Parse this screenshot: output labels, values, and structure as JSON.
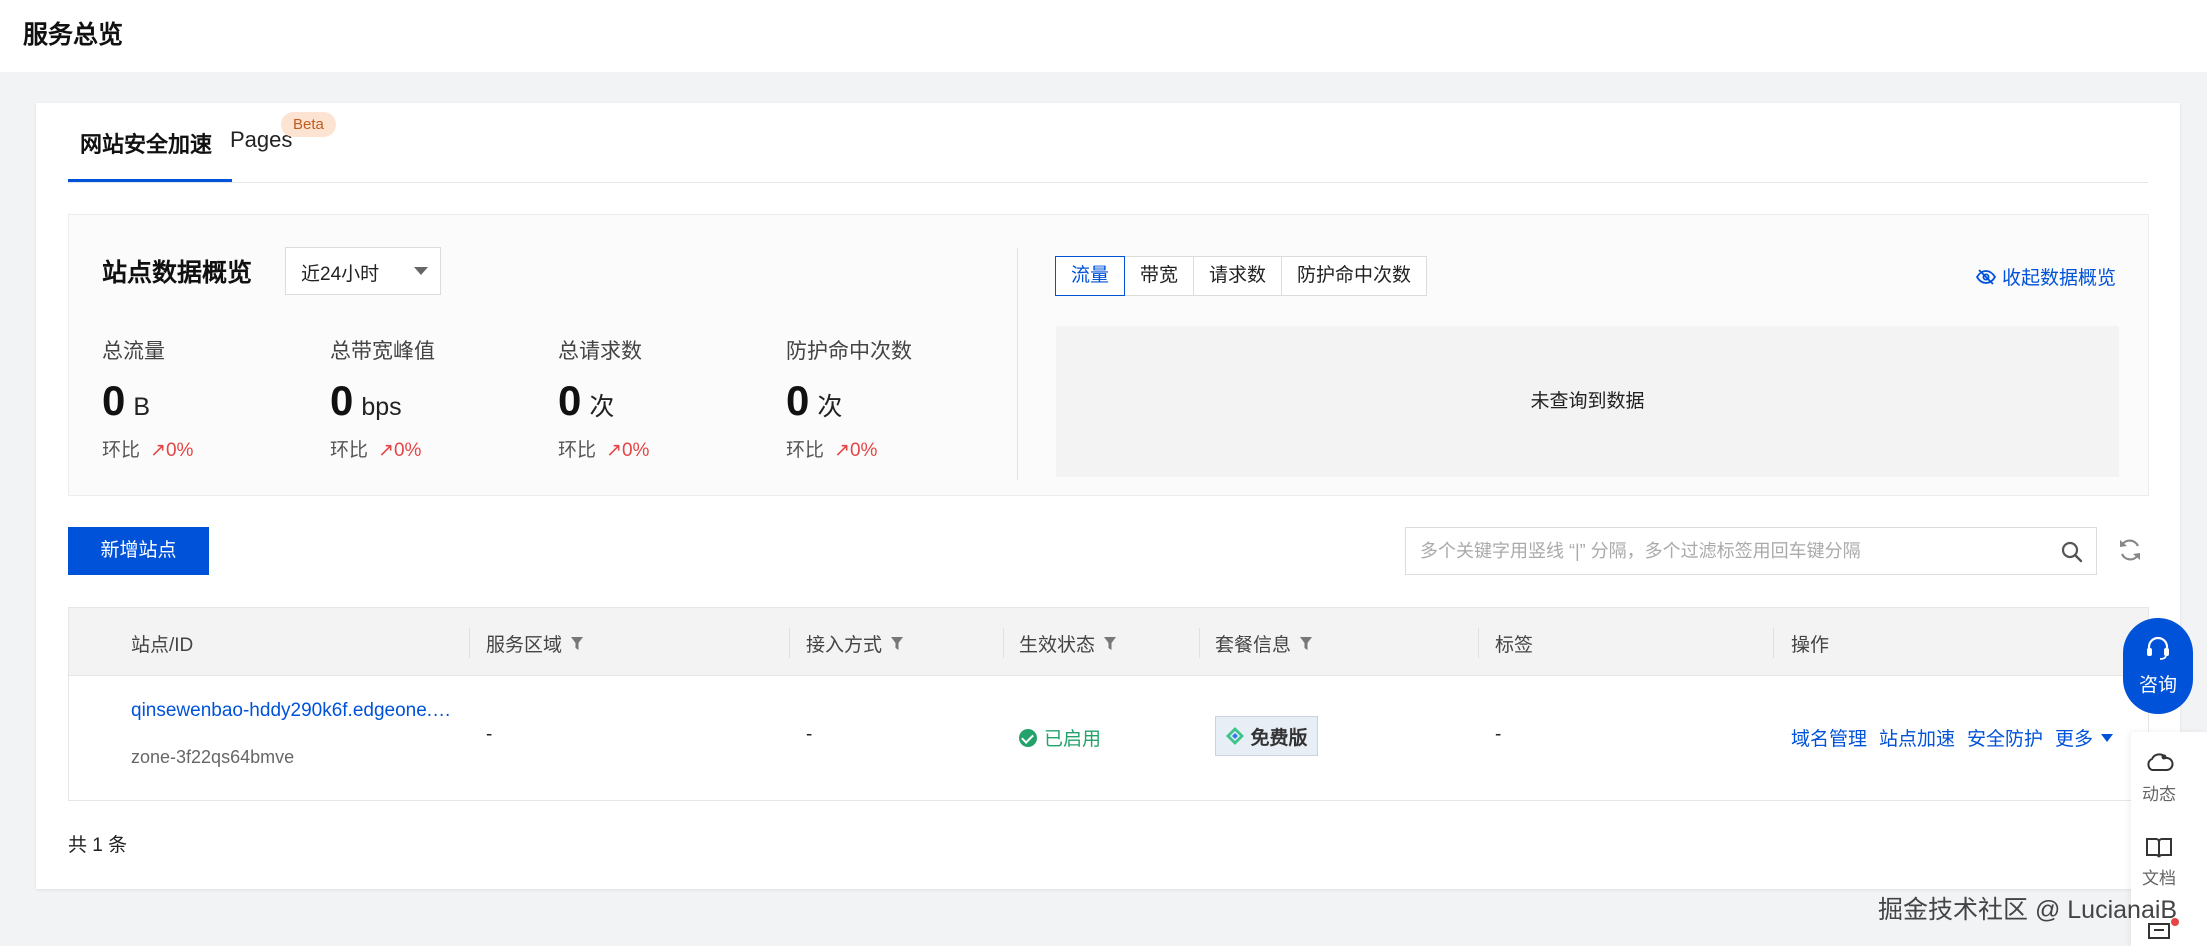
{
  "page": {
    "title": "服务总览"
  },
  "tabs": [
    {
      "label": "网站安全加速",
      "active": true
    },
    {
      "label": "Pages",
      "badge": "Beta",
      "active": false
    }
  ],
  "overview": {
    "title": "站点数据概览",
    "range": "近24小时",
    "stats": [
      {
        "label": "总流量",
        "value": "0",
        "unit": "B",
        "compare_label": "环比",
        "compare_value": "0%"
      },
      {
        "label": "总带宽峰值",
        "value": "0",
        "unit": "bps",
        "compare_label": "环比",
        "compare_value": "0%"
      },
      {
        "label": "总请求数",
        "value": "0",
        "unit": "次",
        "compare_label": "环比",
        "compare_value": "0%"
      },
      {
        "label": "防护命中次数",
        "value": "0",
        "unit": "次",
        "compare_label": "环比",
        "compare_value": "0%"
      }
    ],
    "metric_tabs": [
      "流量",
      "带宽",
      "请求数",
      "防护命中次数"
    ],
    "active_metric": "流量",
    "collapse_label": "收起数据概览",
    "empty_text": "未查询到数据"
  },
  "toolbar": {
    "add_label": "新增站点",
    "search_placeholder": "多个关键字用竖线 “|” 分隔，多个过滤标签用回车键分隔"
  },
  "table": {
    "columns": [
      "站点/ID",
      "服务区域",
      "接入方式",
      "生效状态",
      "套餐信息",
      "标签",
      "操作"
    ],
    "rows": [
      {
        "site": "qinsewenbao-hddy290k6f.edgeone.…",
        "id": "zone-3f22qs64bmve",
        "region": "-",
        "access": "-",
        "status": "已启用",
        "plan": "免费版",
        "tags": "-",
        "ops": [
          "域名管理",
          "站点加速",
          "安全防护",
          "更多"
        ]
      }
    ],
    "total": "共 1 条"
  },
  "floating": {
    "consult": "咨询",
    "items": [
      "动态",
      "文档"
    ]
  },
  "watermark": "掘金技术社区 @ LucianaiB",
  "colors": {
    "primary": "#0052d9",
    "success": "#23a36b",
    "danger": "#e54545"
  }
}
